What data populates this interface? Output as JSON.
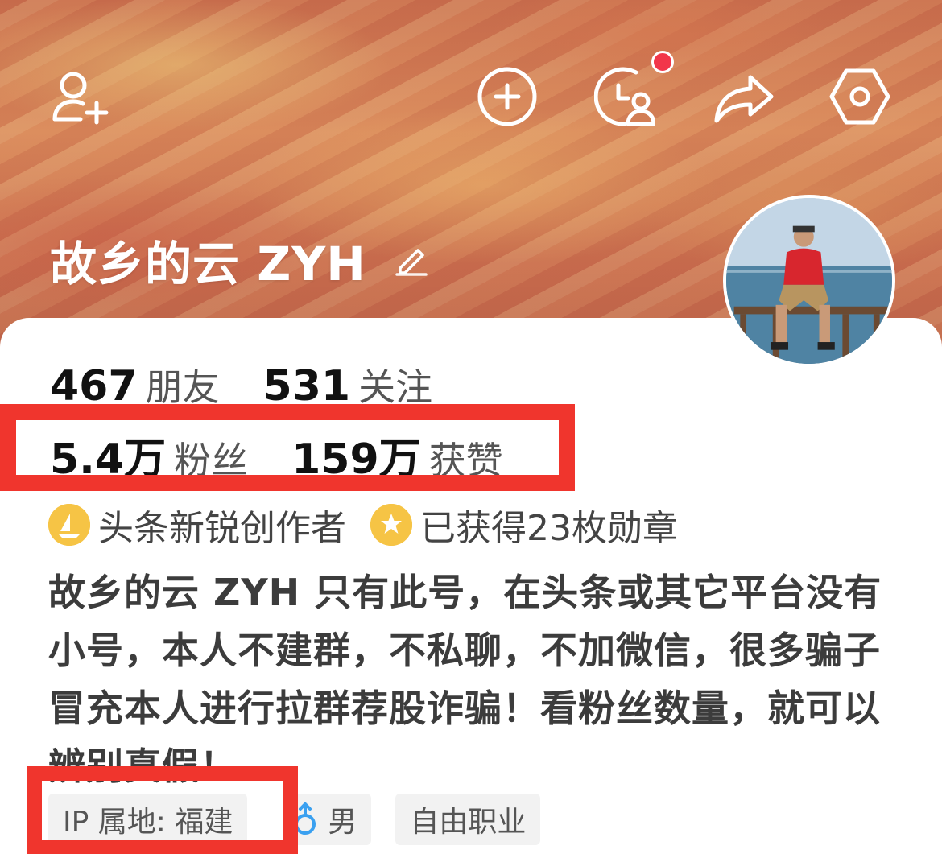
{
  "header": {
    "notification_dot_color": "#f2364a",
    "icons": [
      "add-friend-icon",
      "plus-circle-icon",
      "history-icon",
      "share-icon",
      "settings-icon"
    ]
  },
  "profile": {
    "name": "故乡的云 ZYH",
    "avatar_alt": "avatar"
  },
  "stats": {
    "friends_count": "467",
    "friends_label": "朋友",
    "following_count": "531",
    "following_label": "关注",
    "followers_count": "5.4万",
    "followers_label": "粉丝",
    "likes_count": "159万",
    "likes_label": "获赞"
  },
  "badges": [
    {
      "icon": "sailboat-icon",
      "text": "头条新锐创作者"
    },
    {
      "icon": "star-icon",
      "text": "已获得23枚勋章"
    }
  ],
  "bio": "故乡的云 ZYH 只有此号，在头条或其它平台没有小号，本人不建群，不私聊，不加微信，很多骗子冒充本人进行拉群荐股诈骗！看粉丝数量，就可以辨别真假！",
  "tags": {
    "ip": "IP 属地: 福建",
    "gender": "男",
    "occupation": "自由职业"
  },
  "annotations": {
    "highlight_color": "#f0352d"
  }
}
